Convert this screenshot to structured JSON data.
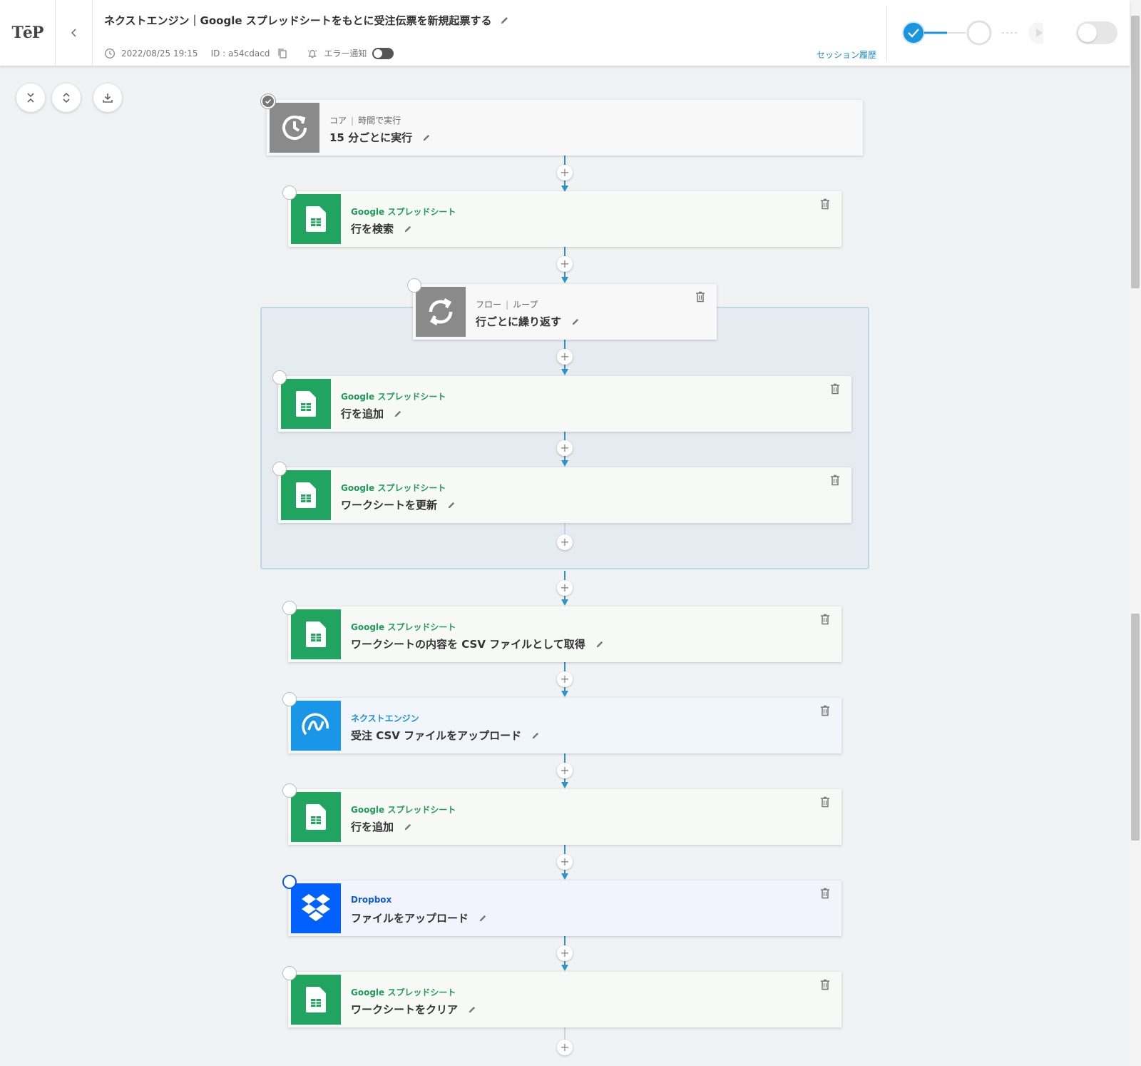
{
  "header": {
    "logo": "TēP",
    "title": "ネクストエンジン｜Google スプレッドシートをもとに受注伝票を新規起票する",
    "datetime": "2022/08/25 19:15",
    "id_text": "ID : a54cdacd",
    "error_notify_label": "エラー通知",
    "session_history_label": "セッション履歴"
  },
  "colors": {
    "accent": "#1a87c9",
    "connector": "#2c94c6",
    "sheets_green": "#20a45f",
    "ne_blue": "#1a96e8",
    "dropbox_blue": "#0061fe",
    "core_gray": "#8a8a8a"
  },
  "tools": {
    "collapse_icon": "collapse-all-icon",
    "expand_icon": "expand-all-icon",
    "download_icon": "download-icon"
  },
  "steps": [
    {
      "service": "コア",
      "category": "時間で実行",
      "action": "15 分ごとに実行",
      "icon": "clock-refresh-icon"
    },
    {
      "service": "Google スプレッドシート",
      "action": "行を検索",
      "icon": "google-sheets-icon"
    },
    {
      "service": "フロー",
      "category": "ループ",
      "action": "行ごとに繰り返す",
      "icon": "loop-icon"
    },
    {
      "service": "Google スプレッドシート",
      "action": "行を追加",
      "icon": "google-sheets-icon"
    },
    {
      "service": "Google スプレッドシート",
      "action": "ワークシートを更新",
      "icon": "google-sheets-icon"
    },
    {
      "service": "Google スプレッドシート",
      "action": "ワークシートの内容を CSV ファイルとして取得",
      "icon": "google-sheets-icon"
    },
    {
      "service": "ネクストエンジン",
      "action": "受注 CSV ファイルをアップロード",
      "icon": "next-engine-icon"
    },
    {
      "service": "Google スプレッドシート",
      "action": "行を追加",
      "icon": "google-sheets-icon"
    },
    {
      "service": "Dropbox",
      "action": "ファイルをアップロード",
      "icon": "dropbox-icon"
    },
    {
      "service": "Google スプレッドシート",
      "action": "ワークシートをクリア",
      "icon": "google-sheets-icon"
    }
  ]
}
